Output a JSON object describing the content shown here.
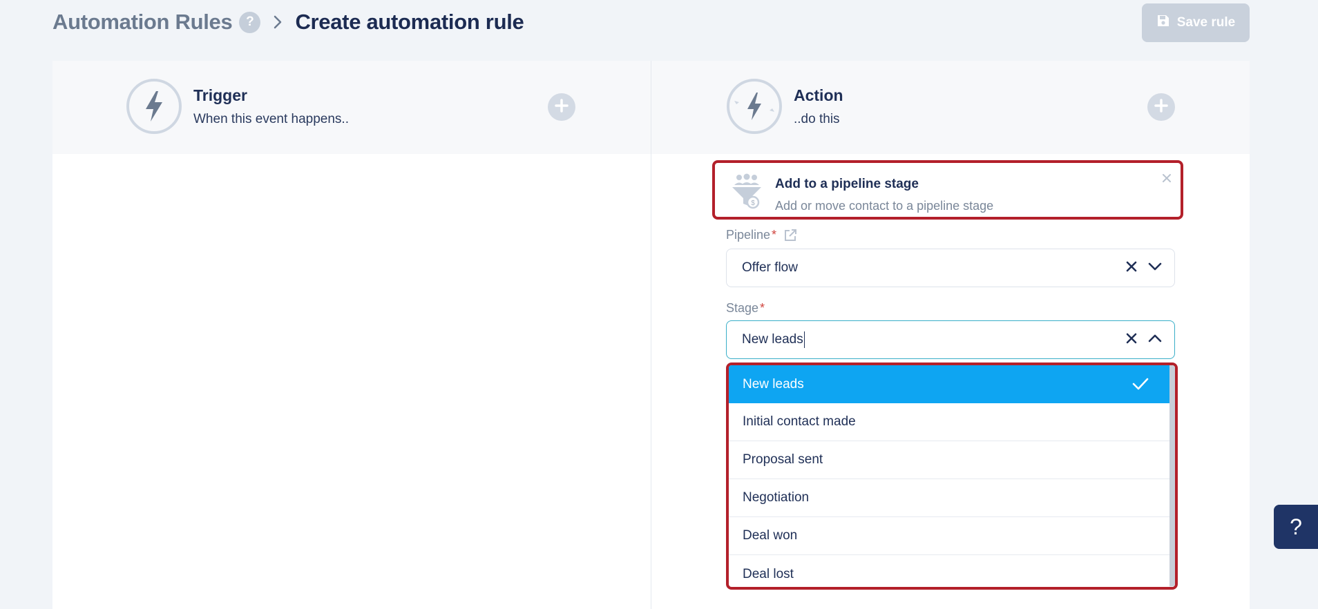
{
  "header": {
    "breadcrumb_parent": "Automation Rules",
    "help_badge": "?",
    "breadcrumb_current": "Create automation rule",
    "save_label": "Save rule"
  },
  "trigger": {
    "title": "Trigger",
    "subtitle": "When this event happens.."
  },
  "action": {
    "title": "Action",
    "subtitle": "..do this",
    "card": {
      "title": "Add to a pipeline stage",
      "subtitle": "Add or move contact to a pipeline stage"
    }
  },
  "form": {
    "pipeline": {
      "label": "Pipeline",
      "required_mark": "*",
      "value": "Offer flow"
    },
    "stage": {
      "label": "Stage",
      "required_mark": "*",
      "value": "New leads",
      "options": [
        "New leads",
        "Initial contact made",
        "Proposal sent",
        "Negotiation",
        "Deal won",
        "Deal lost"
      ],
      "selected_index": 0
    }
  },
  "help_float": "?",
  "colors": {
    "accent_selected": "#0ea5f2",
    "highlight_border": "#b3202a",
    "navy": "#1f2f56",
    "help_float_bg": "#1f3466"
  },
  "icons": {
    "trigger": "lightning-icon",
    "action": "lightning-cycle-icon",
    "add": "plus-icon",
    "close": "close-icon",
    "pipeline": "people-funnel-icon",
    "external": "external-link-icon",
    "clear": "x-icon",
    "expand": "chevron-down-icon",
    "collapse": "chevron-up-icon",
    "selected": "check-icon",
    "save": "floppy-disk-icon"
  }
}
